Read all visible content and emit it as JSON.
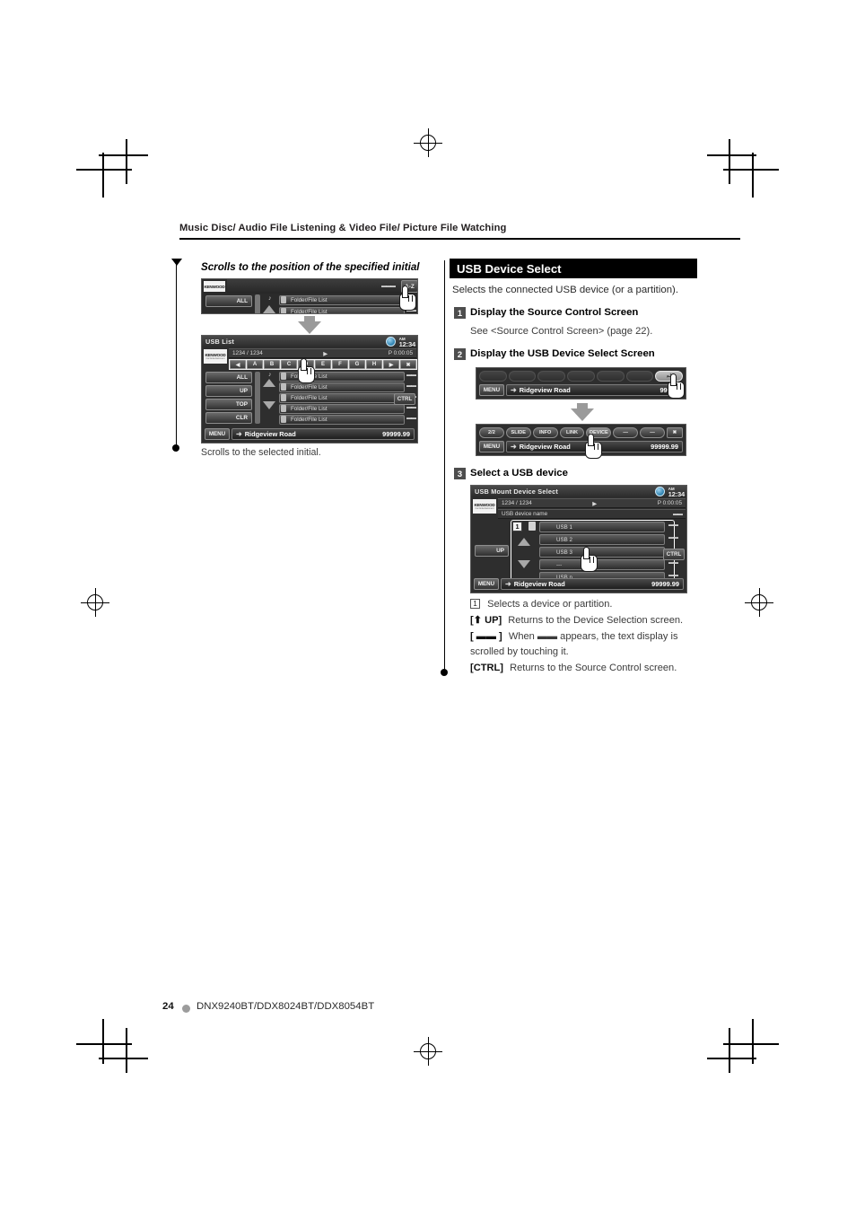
{
  "page": {
    "header_title": "Music Disc/ Audio File Listening & Video File/ Picture File Watching",
    "footer_page_number": "24",
    "footer_models": "DNX9240BT/DDX8024BT/DDX8054BT"
  },
  "left_column": {
    "heading": "Scrolls to the position of the specified initial",
    "caption": "Scrolls to the selected initial.",
    "top_shot": {
      "az_button": "A-Z",
      "all_button": "ALL",
      "list_rows": [
        "Folder/File List",
        "Folder/File List"
      ],
      "dots_glyph": "▬▬▬"
    },
    "usb_list_shot": {
      "title": "USB List",
      "clock_ampm": "AM",
      "clock_time": "12:34",
      "track_count": "1234 / 1234",
      "play_time": "P 0:00:05",
      "brand": "KENWOOD",
      "brand_sub": "Car Entertainment",
      "alphabet_keys": [
        "◀",
        "A",
        "B",
        "C",
        "D",
        "E",
        "F",
        "G",
        "H",
        "▶"
      ],
      "close_key": "✖",
      "side_buttons": [
        "ALL",
        "UP",
        "TOP",
        "CLR"
      ],
      "list_rows": [
        "Folder/File List",
        "Folder/File List",
        "Folder/File List",
        "Folder/File List",
        "Folder/File List"
      ],
      "ctrl_button": "CTRL",
      "menu_button": "MENU",
      "track_name": "Ridgeview Road",
      "track_value": "99999.99"
    }
  },
  "right_column": {
    "section_title": "USB Device Select",
    "section_intro": "Selects the connected USB device (or a partition).",
    "steps": [
      {
        "number": "1",
        "title": "Display the Source Control Screen",
        "body": "See <Source Control Screen> (page 22)."
      },
      {
        "number": "2",
        "title": "Display the USB Device Select Screen",
        "body": ""
      },
      {
        "number": "3",
        "title": "Select a USB device",
        "body": ""
      }
    ],
    "source_shot": {
      "menu_button": "MENU",
      "track_name": "Ridgeview Road",
      "track_value": "99999"
    },
    "pill_shot": {
      "pills": [
        "2/2",
        "SLIDE",
        "INFO",
        "LINK",
        "DEVICE",
        "—",
        "—"
      ],
      "close_key": "✖",
      "menu_button": "MENU",
      "track_name": "Ridgeview Road",
      "track_value": "99999.99"
    },
    "device_shot": {
      "title": "USB Mount Device Select",
      "clock_ampm": "AM",
      "clock_time": "12:34",
      "track_count": "1234 / 1234",
      "play_time": "P 0:00:05",
      "brand": "KENWOOD",
      "brand_sub": "Car Entertainment",
      "device_name_label": "USB device name",
      "callout_number": "1",
      "device_rows": [
        "USB 1",
        "USB 2",
        "USB 3",
        "---",
        "USB n"
      ],
      "up_button": "UP",
      "ctrl_button": "CTRL",
      "menu_button": "MENU",
      "track_name": "Ridgeview Road",
      "track_value": "99999.99"
    },
    "legend": [
      {
        "key": "1",
        "key_type": "numbox",
        "text": "Selects a device or partition."
      },
      {
        "key": "[⬆ UP]",
        "key_type": "bold",
        "text": "Returns to the Device Selection screen."
      },
      {
        "key": "[ ▬▬ ]",
        "key_type": "bold",
        "text": "When ▬▬ appears, the text display is scrolled by touching it."
      },
      {
        "key": "[CTRL]",
        "key_type": "bold",
        "text": "Returns to the Source Control screen."
      }
    ]
  }
}
